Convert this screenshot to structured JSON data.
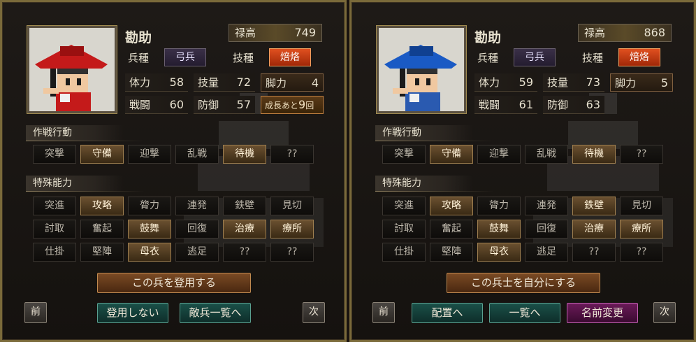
{
  "panels": [
    {
      "name": "勘助",
      "rokudaka_label": "禄高",
      "rokudaka": "749",
      "heishu_label": "兵種",
      "heishu": "弓兵",
      "gikei_label": "技種",
      "gikei": "焙烙",
      "stats": {
        "tairyoku_l": "体力",
        "tairyoku": "58",
        "giryo_l": "技量",
        "giryo": "72",
        "kyakuryoku_l": "脚力",
        "kyakuryoku": "4",
        "sento_l": "戦闘",
        "sento": "60",
        "bogyo_l": "防御",
        "bogyo": "57"
      },
      "growth_label": "成長あと",
      "growth_value": "9",
      "growth_unit": "回",
      "tactics_title": "作戦行動",
      "tactics": [
        "突撃",
        "守備",
        "迎撃",
        "乱戦",
        "待機",
        "??"
      ],
      "abilities_title": "特殊能力",
      "abilities": [
        [
          "突進",
          "攻略",
          "膂力",
          "連発",
          "鉄壁",
          "見切"
        ],
        [
          "討取",
          "奮起",
          "鼓舞",
          "回復",
          "治療",
          "療所"
        ],
        [
          "仕掛",
          "堅陣",
          "母衣",
          "逃足",
          "??",
          "??"
        ]
      ],
      "main_button": "この兵を登用する",
      "buttons": [
        "登用しない",
        "敵兵一覧へ"
      ],
      "prev": "前",
      "next": "次",
      "hat_color": "#c41a1a",
      "outfit_color": "#c41a1a"
    },
    {
      "name": "勘助",
      "rokudaka_label": "禄高",
      "rokudaka": "868",
      "heishu_label": "兵種",
      "heishu": "弓兵",
      "gikei_label": "技種",
      "gikei": "焙烙",
      "stats": {
        "tairyoku_l": "体力",
        "tairyoku": "59",
        "giryo_l": "技量",
        "giryo": "73",
        "kyakuryoku_l": "脚力",
        "kyakuryoku": "5",
        "sento_l": "戦闘",
        "sento": "61",
        "bogyo_l": "防御",
        "bogyo": "63"
      },
      "tactics_title": "作戦行動",
      "tactics": [
        "突撃",
        "守備",
        "迎撃",
        "乱戦",
        "待機",
        "??"
      ],
      "abilities_title": "特殊能力",
      "abilities": [
        [
          "突進",
          "攻略",
          "膂力",
          "連発",
          "鉄壁",
          "見切"
        ],
        [
          "討取",
          "奮起",
          "鼓舞",
          "回復",
          "治療",
          "療所"
        ],
        [
          "仕掛",
          "堅陣",
          "母衣",
          "逃足",
          "??",
          "??"
        ]
      ],
      "main_button": "この兵士を自分にする",
      "buttons": [
        "配置へ",
        "一覧へ",
        "名前変更"
      ],
      "prev": "前",
      "next": "次",
      "hat_color": "#1a5ac4",
      "outfit_color": "#2a5ab0"
    }
  ]
}
